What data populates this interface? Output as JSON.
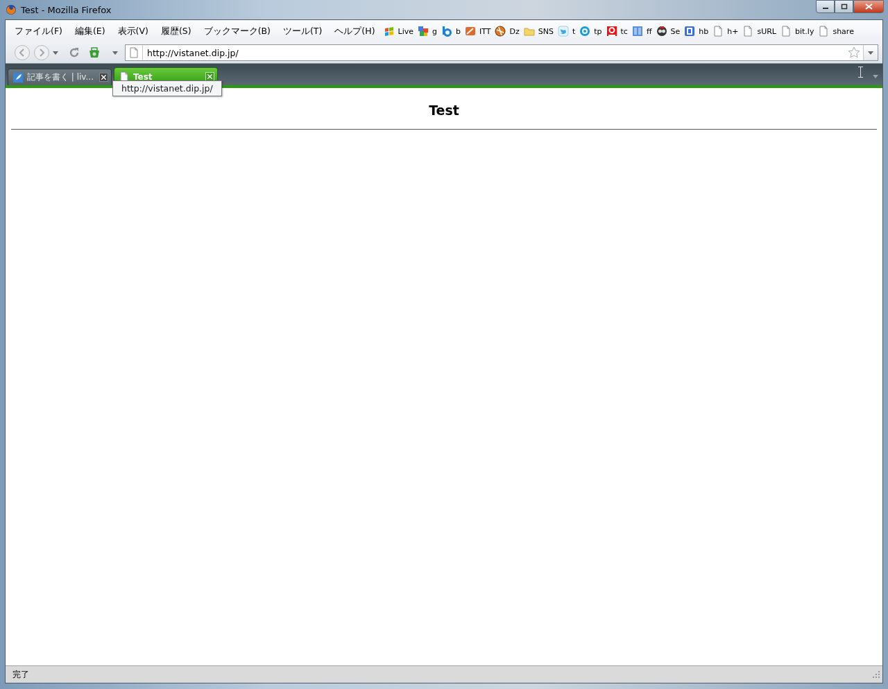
{
  "window": {
    "title": "Test - Mozilla Firefox"
  },
  "menu": [
    "ファイル(F)",
    "編集(E)",
    "表示(V)",
    "履歴(S)",
    "ブックマーク(B)",
    "ツール(T)",
    "ヘルプ(H)"
  ],
  "bookmarks": [
    {
      "kind": "windows",
      "label": "Live"
    },
    {
      "kind": "google",
      "label": "g"
    },
    {
      "kind": "bing",
      "label": "b"
    },
    {
      "kind": "itt",
      "label": "ITT"
    },
    {
      "kind": "dz",
      "label": "Dz"
    },
    {
      "kind": "folder",
      "label": "SNS"
    },
    {
      "kind": "twitter",
      "label": "t"
    },
    {
      "kind": "tp",
      "label": "tp"
    },
    {
      "kind": "tc",
      "label": "tc"
    },
    {
      "kind": "ff",
      "label": "ff"
    },
    {
      "kind": "se",
      "label": "Se"
    },
    {
      "kind": "hb",
      "label": "hb"
    },
    {
      "kind": "page",
      "label": "h+"
    },
    {
      "kind": "page",
      "label": "sURL"
    },
    {
      "kind": "page",
      "label": "bit.ly"
    },
    {
      "kind": "page",
      "label": "share"
    }
  ],
  "address": {
    "value": "http://vistanet.dip.jp/"
  },
  "tabs": [
    {
      "kind": "feather",
      "label": "記事を書く | liv...",
      "selected": false
    },
    {
      "kind": "page",
      "label": "Test",
      "selected": true
    }
  ],
  "tooltip": "http://vistanet.dip.jp/",
  "page": {
    "heading": "Test"
  },
  "status_bar": "完了"
}
